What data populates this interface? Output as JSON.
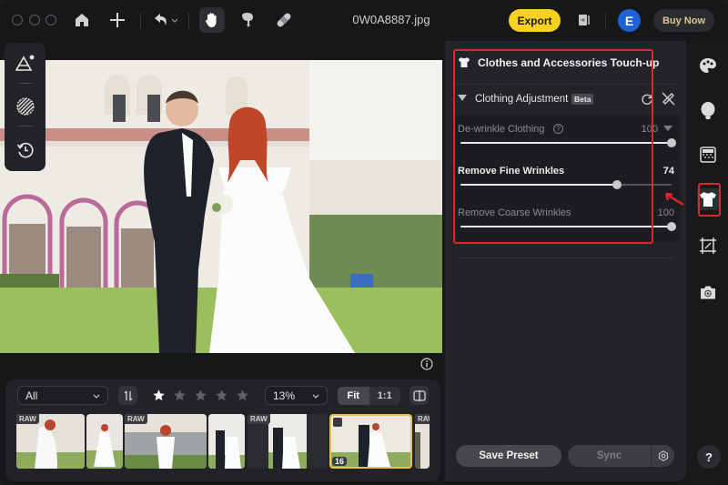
{
  "window": {
    "filename": "0W0A8887.jpg"
  },
  "toolbar": {
    "icons": [
      "home-icon",
      "plus-icon",
      "undo-icon",
      "hand-icon",
      "smudge-icon",
      "bandage-icon"
    ],
    "export_label": "Export",
    "avatar_letter": "E",
    "buy_label": "Buy Now"
  },
  "left_tools": [
    "mask-triangle-icon",
    "selection-circle-icon",
    "history-icon"
  ],
  "filmstrip": {
    "filter": "All",
    "rating": 1,
    "rating_max": 5,
    "zoom": "13%",
    "fit_label": "Fit",
    "one_to_one_label": "1:1",
    "thumbnails": [
      {
        "badge": "RAW",
        "selected": false
      },
      {
        "badge": "",
        "selected": false
      },
      {
        "badge": "RAW",
        "selected": false
      },
      {
        "badge": "",
        "selected": false
      },
      {
        "badge": "RAW",
        "selected": false
      },
      {
        "badge": "",
        "selected": true,
        "count": "16",
        "edited": true
      },
      {
        "badge": "RAW",
        "selected": false
      }
    ]
  },
  "panel": {
    "section_title": "Clothes and Accessories Touch-up",
    "sub_title": "Clothing Adjustment",
    "beta_label": "Beta",
    "sliders": [
      {
        "label": "De-wrinkle Clothing",
        "value": "100",
        "fraction": 1.0,
        "has_help": true,
        "dim": true
      },
      {
        "label": "Remove Fine Wrinkles",
        "value": "74",
        "fraction": 0.74,
        "dim": false
      },
      {
        "label": "Remove Coarse Wrinkles",
        "value": "100",
        "fraction": 1.0,
        "dim": true
      }
    ],
    "save_preset_label": "Save Preset",
    "sync_label": "Sync"
  },
  "toolrail": {
    "icons": [
      "palette-icon",
      "face-icon",
      "texture-icon",
      "shirt-icon",
      "crop-icon",
      "camera-icon"
    ],
    "active": "shirt-icon",
    "help_label": "?"
  },
  "colors": {
    "accent_yellow": "#f6d21c",
    "avatar_blue": "#1e63d6",
    "annotation_red": "#e0262b"
  }
}
